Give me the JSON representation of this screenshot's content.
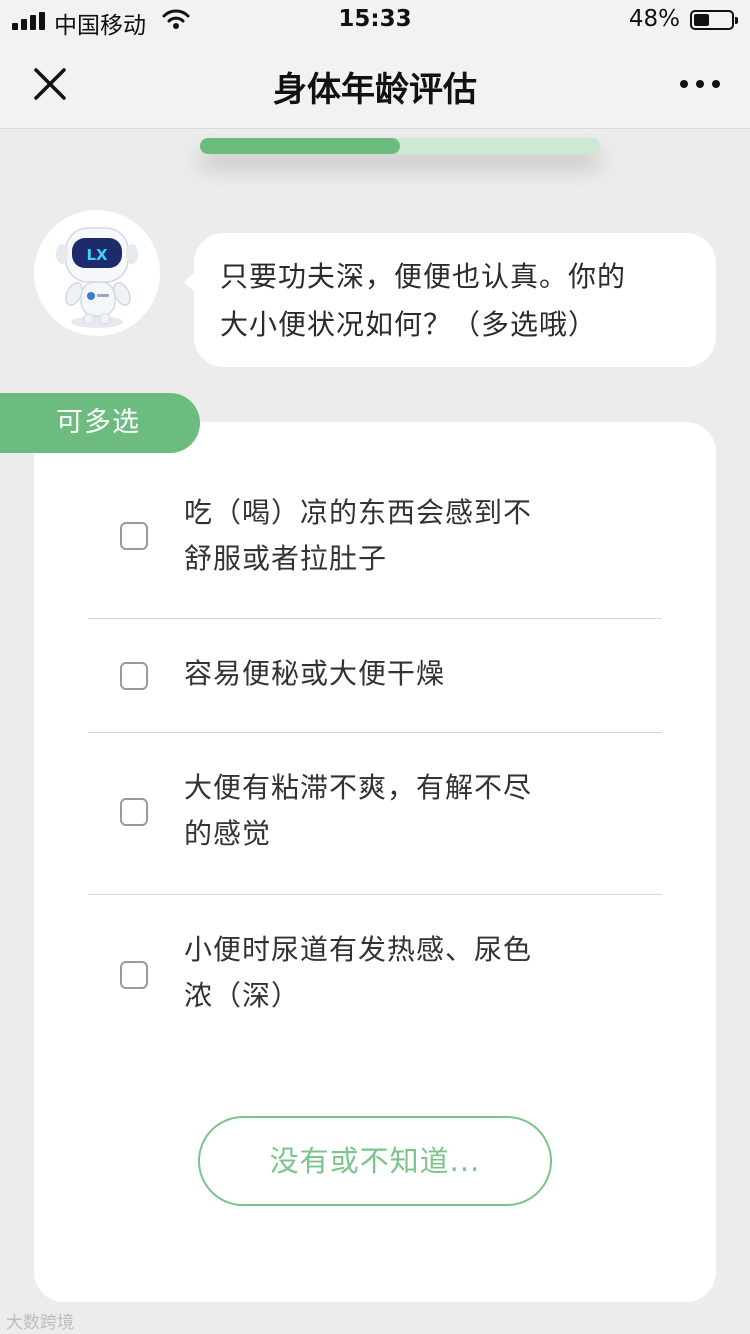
{
  "status_bar": {
    "carrier": "中国移动",
    "time": "15:33",
    "battery_percent": "48%",
    "battery_level": 0.48
  },
  "nav": {
    "title": "身体年龄评估",
    "close_icon": "close-icon",
    "more_icon": "more-icon"
  },
  "progress": {
    "value": 0.5
  },
  "bot": {
    "avatar_icon": "robot-avatar",
    "avatar_text": "LX",
    "message_lines": [
      "只要功夫深，便便也认真。你的",
      "大小便状况如何？（多选哦）"
    ]
  },
  "question": {
    "tag": "可多选",
    "options": [
      {
        "lines": [
          "吃（喝）凉的东西会感到不",
          "舒服或者拉肚子"
        ],
        "checked": false
      },
      {
        "lines": [
          "容易便秘或大便干燥"
        ],
        "checked": false
      },
      {
        "lines": [
          "大便有粘滞不爽，有解不尽",
          "的感觉"
        ],
        "checked": false
      },
      {
        "lines": [
          "小便时尿道有发热感、尿色",
          "浓（深）"
        ],
        "checked": false
      }
    ],
    "none_button": "没有或不知道..."
  },
  "watermark": "大数跨境",
  "colors": {
    "accent": "#6cbc80",
    "accent_light": "#cfe8d4",
    "background": "#ececec"
  }
}
